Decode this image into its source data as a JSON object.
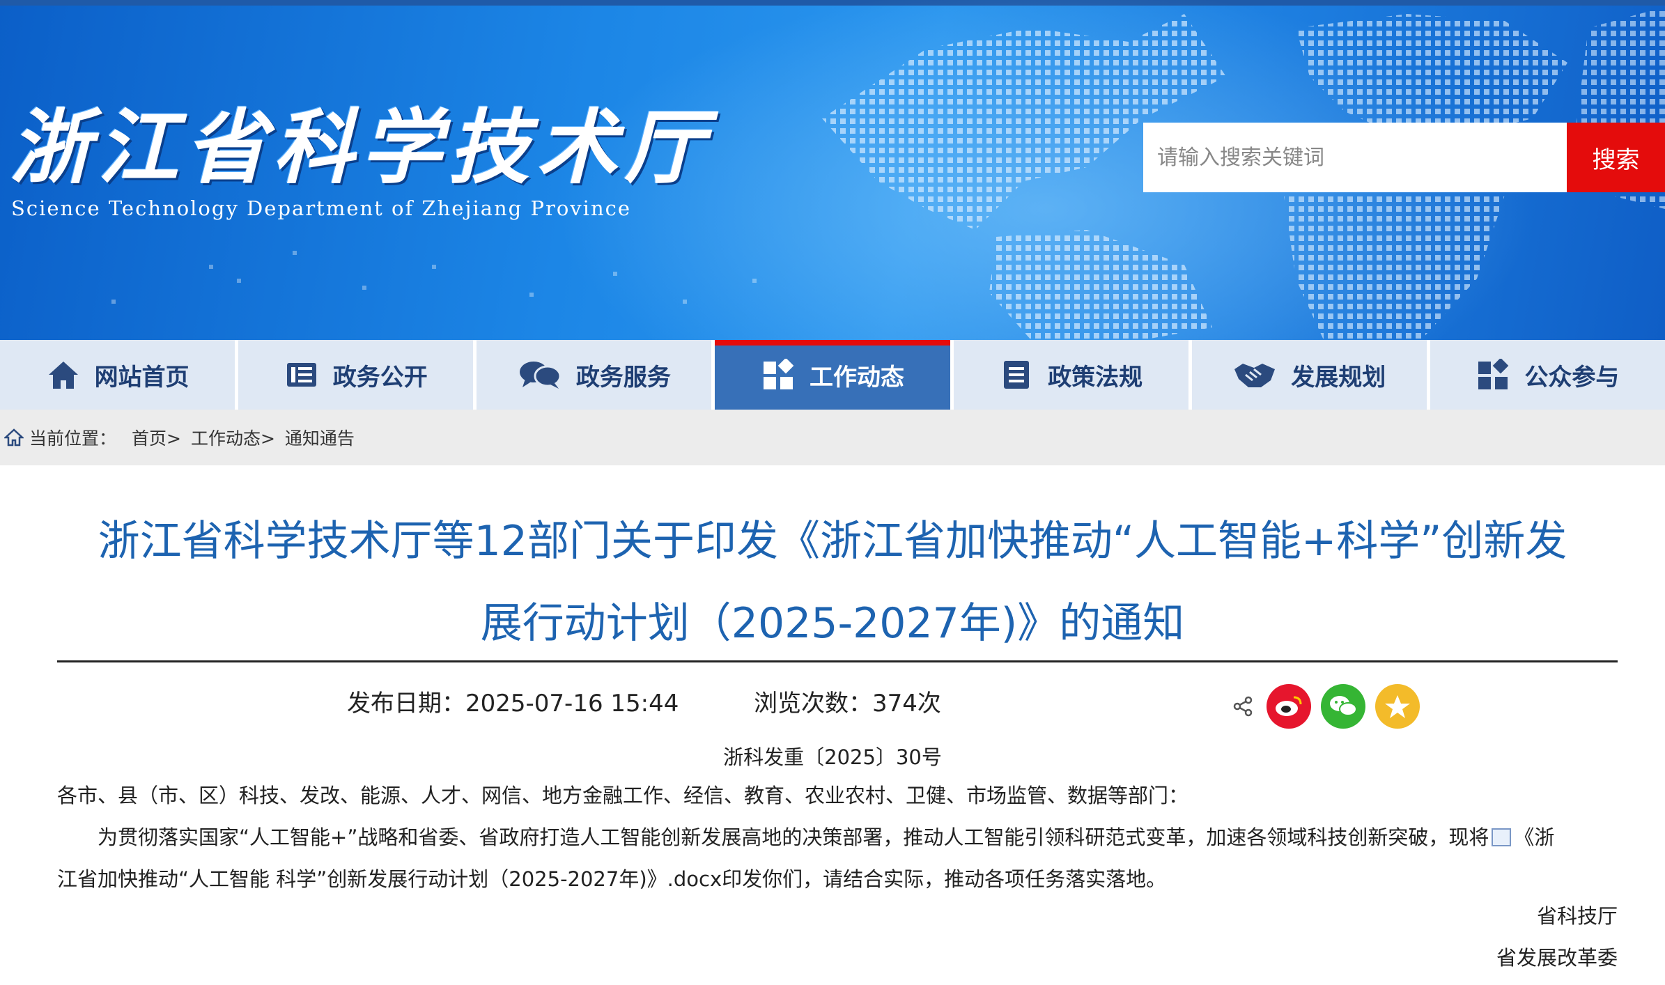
{
  "header": {
    "logo_cn": "浙江省科学技术厅",
    "logo_en": "Science Technology Department of Zhejiang Province",
    "search_placeholder": "请输入搜索关键词",
    "search_button": "搜索"
  },
  "nav": {
    "items": [
      {
        "label": "网站首页",
        "icon": "home-icon"
      },
      {
        "label": "政务公开",
        "icon": "list-icon"
      },
      {
        "label": "政务服务",
        "icon": "chat-icon"
      },
      {
        "label": "工作动态",
        "icon": "grid-icon",
        "active": true
      },
      {
        "label": "政策法规",
        "icon": "document-icon"
      },
      {
        "label": "发展规划",
        "icon": "handshake-icon"
      },
      {
        "label": "公众参与",
        "icon": "grid-icon"
      }
    ]
  },
  "breadcrumb": {
    "prefix": "当前位置：",
    "items": [
      "首页>",
      "工作动态>",
      "通知通告"
    ]
  },
  "article": {
    "title_line1": "浙江省科学技术厅等12部门关于印发《浙江省加快推动“人工智能+科学”创新发",
    "title_line2": "展行动计划（2025-2027年)》的通知",
    "publish_date": "发布日期：2025-07-16 15:44",
    "view_count": "浏览次数：374次",
    "doc_number": "浙科发重〔2025〕30号",
    "recipients": "各市、县（市、区）科技、发改、能源、人才、网信、地方金融工作、经信、教育、农业农村、卫健、市场监管、数据等部门：",
    "body_part1": "为贯彻落实国家“人工智能+”战略和省委、省政府打造人工智能创新发展高地的决策部署，推动人工智能引领科研范式变革，加速各领域科技创新突破，现将",
    "body_part2": "《浙",
    "body_line2": "江省加快推动“人工智能 科学”创新发展行动计划（2025-2027年)》.docx印发你们，请结合实际，推动各项任务落实落地。",
    "signature1": "省科技厅",
    "signature2": "省发展改革委"
  },
  "share": {
    "icons": [
      "share-icon",
      "weibo-icon",
      "wechat-icon",
      "favorite-icon"
    ]
  },
  "colors": {
    "banner": "#1c86e6",
    "accent_red": "#e40c0c",
    "nav_active": "#3770b8",
    "nav_bg": "#dfe8f4",
    "title": "#1d63b0"
  }
}
